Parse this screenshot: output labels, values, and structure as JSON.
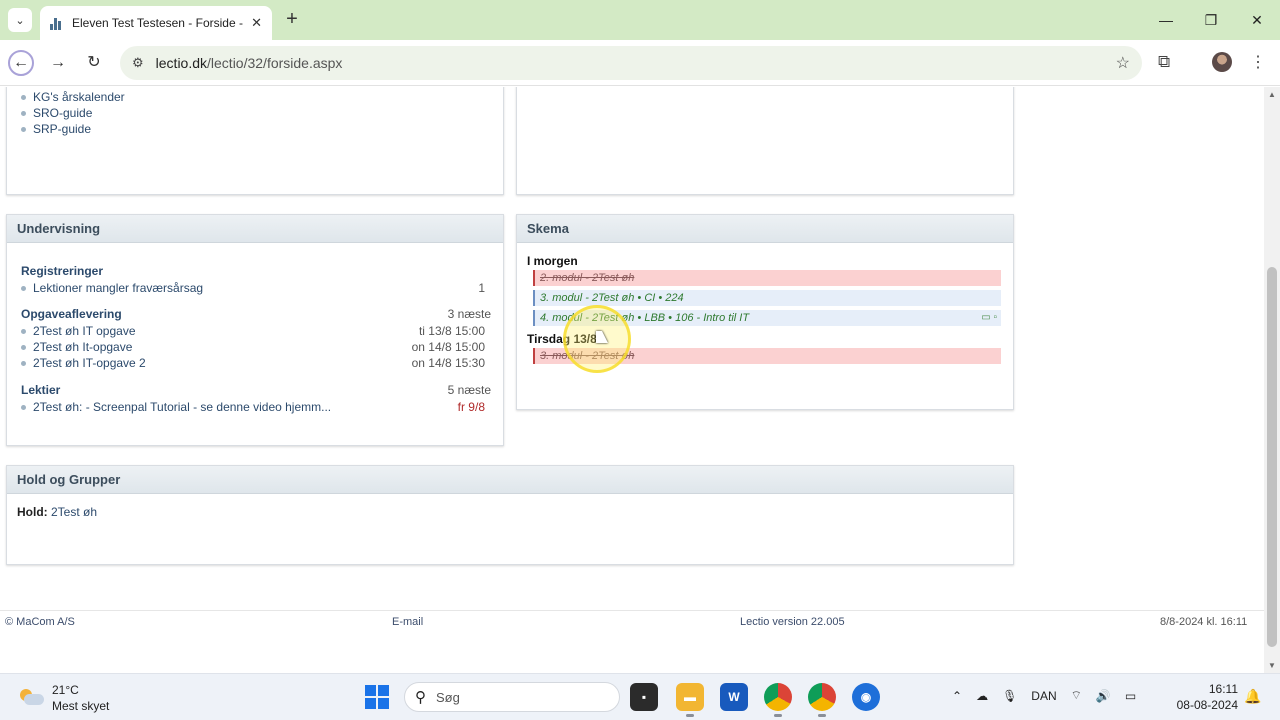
{
  "browser": {
    "tab_title": "Eleven Test Testesen - Forside -",
    "url_domain": "lectio.dk",
    "url_path": "/lectio/32/forside.aspx"
  },
  "links_top": [
    "KG's årskalender",
    "SRO-guide",
    "SRP-guide"
  ],
  "undervisning": {
    "title": "Undervisning",
    "registreringer": {
      "title": "Registreringer",
      "items": [
        {
          "label": "Lektioner mangler fraværsårsag",
          "value": "1"
        }
      ]
    },
    "opgaver": {
      "title": "Opgaveaflevering",
      "count": "3 næste",
      "items": [
        {
          "label": "2Test øh IT opgave",
          "value": "ti 13/8 15:00"
        },
        {
          "label": "2Test øh It-opgave",
          "value": "on 14/8 15:00"
        },
        {
          "label": "2Test øh IT-opgave 2",
          "value": "on 14/8 15:30"
        }
      ]
    },
    "lektier": {
      "title": "Lektier",
      "count": "5 næste",
      "items": [
        {
          "label": "2Test øh: - Screenpal Tutorial - se denne video hjemm...",
          "value": "fr 9/8"
        }
      ]
    }
  },
  "skema": {
    "title": "Skema",
    "day1": "I morgen",
    "day1_lessons": [
      {
        "text": "2. modul - 2Test øh",
        "status": "cancel"
      },
      {
        "text": "3. modul - 2Test øh • CI • 224",
        "status": "changed"
      },
      {
        "text": "4. modul - 2Test øh • LBB • 106 - Intro til IT",
        "status": "changed"
      }
    ],
    "day2": "Tirsdag 13/8",
    "day2_lessons": [
      {
        "text": "3. modul - 2Test øh",
        "status": "cancel"
      }
    ]
  },
  "hold": {
    "title": "Hold og Grupper",
    "label": "Hold:",
    "value": "2Test øh"
  },
  "footer": {
    "copyright": "© MaCom A/S",
    "email": "E-mail",
    "version": "Lectio version 22.005",
    "time": "8/8-2024  kl. 16:11"
  },
  "taskbar": {
    "temp": "21°C",
    "weather": "Mest skyet",
    "search_placeholder": "Søg",
    "lang": "DAN",
    "time": "16:11",
    "date": "08-08-2024"
  }
}
